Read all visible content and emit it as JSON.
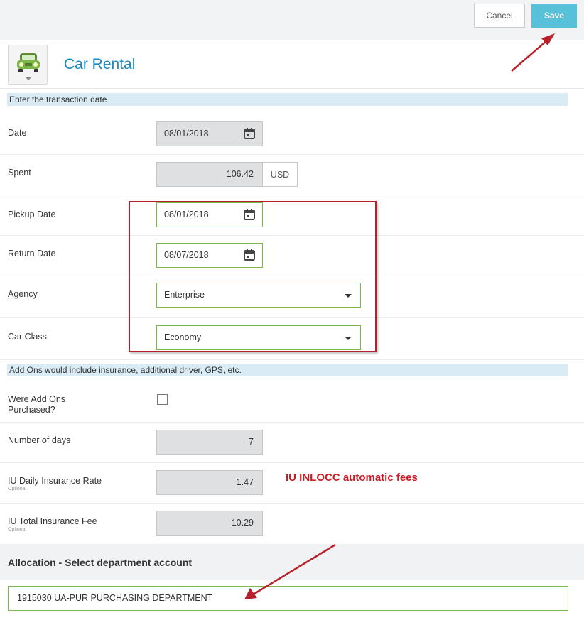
{
  "toolbar": {
    "cancel_label": "Cancel",
    "save_label": "Save",
    "save_color": "#56c1d9"
  },
  "header": {
    "title": "Car Rental",
    "icon": "car-icon"
  },
  "sections": {
    "transaction_hint": "Enter the transaction date",
    "addons_hint": "Add Ons would include insurance, additional driver, GPS, etc."
  },
  "fields": {
    "date": {
      "label": "Date",
      "value": "08/01/2018"
    },
    "spent": {
      "label": "Spent",
      "value": "106.42",
      "currency": "USD"
    },
    "pickup_date": {
      "label": "Pickup Date",
      "value": "08/01/2018"
    },
    "return_date": {
      "label": "Return Date",
      "value": "08/07/2018"
    },
    "agency": {
      "label": "Agency",
      "value": "Enterprise"
    },
    "car_class": {
      "label": "Car Class",
      "value": "Economy"
    },
    "addons_purchased": {
      "label_line1": "Were Add Ons",
      "label_line2": "Purchased?",
      "checked": false
    },
    "number_of_days": {
      "label": "Number of days",
      "value": "7"
    },
    "daily_insurance": {
      "label": "IU Daily Insurance Rate",
      "sublabel": "Optional",
      "value": "1.47"
    },
    "total_insurance": {
      "label": "IU Total Insurance Fee",
      "sublabel": "Optional",
      "value": "10.29"
    }
  },
  "annotation": {
    "text": "IU INLOCC automatic fees",
    "color": "#c81f26"
  },
  "allocation": {
    "title": "Allocation - Select department account",
    "value": "1915030 UA-PUR PURCHASING DEPARTMENT"
  }
}
